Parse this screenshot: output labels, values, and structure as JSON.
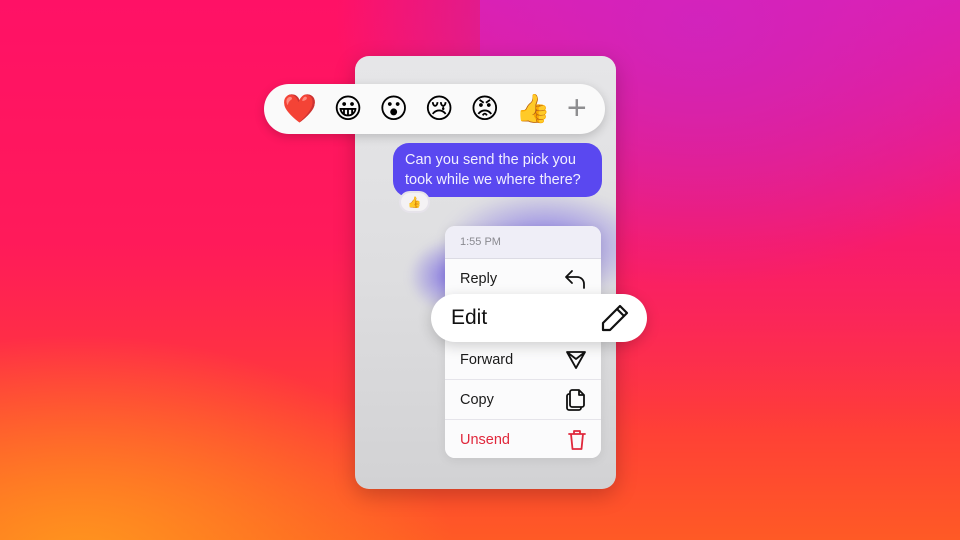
{
  "reactions": {
    "items": [
      {
        "name": "heart",
        "glyph": "❤️"
      },
      {
        "name": "grinning",
        "glyph": "😀"
      },
      {
        "name": "surprised",
        "glyph": "😮"
      },
      {
        "name": "crying",
        "glyph": "😢"
      },
      {
        "name": "angry",
        "glyph": "😡"
      },
      {
        "name": "thumbs-up",
        "glyph": "👍"
      }
    ],
    "more_glyph": "+"
  },
  "message": {
    "text": "Can you send the pick you took while we where there?",
    "reaction_glyph": "👍"
  },
  "context_menu": {
    "timestamp": "1:55 PM",
    "items": [
      {
        "label": "Reply",
        "icon": "reply-icon"
      },
      {
        "label": "Edit",
        "icon": "pencil-icon"
      },
      {
        "label": "Forward",
        "icon": "send-icon"
      },
      {
        "label": "Copy",
        "icon": "copy-icon"
      },
      {
        "label": "Unsend",
        "icon": "trash-icon"
      }
    ]
  },
  "colors": {
    "bubble": "#5a48f0",
    "danger": "#e0283c",
    "background_top_left": "#ff1166",
    "background_top_right": "#d41fbc",
    "background_bottom_left": "#ff8a1e",
    "background_bottom_right": "#ff3a30"
  }
}
